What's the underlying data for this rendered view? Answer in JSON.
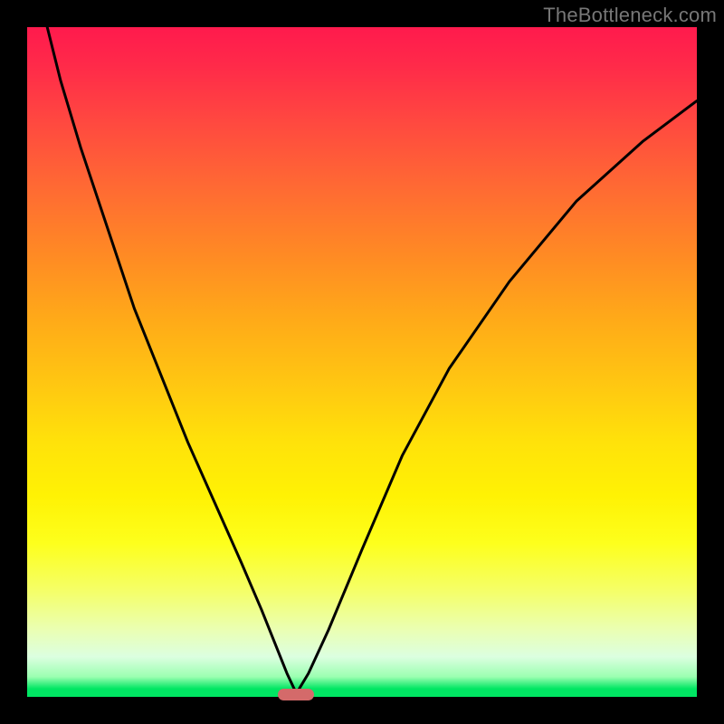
{
  "watermark": "TheBottleneck.com",
  "colors": {
    "frame": "#000000",
    "curve": "#000000",
    "marker": "#d46a6a",
    "green": "#00e663",
    "yellow": "#fff204",
    "orange": "#ff8a24",
    "red": "#ff1a4d"
  },
  "chart_data": {
    "type": "line",
    "title": "",
    "xlabel": "",
    "ylabel": "",
    "xlim": [
      0,
      100
    ],
    "ylim": [
      0,
      100
    ],
    "annotations": [
      {
        "name": "ideal-marker",
        "x": 40.2,
        "y": 0.3,
        "shape": "pill"
      }
    ],
    "series": [
      {
        "name": "bottleneck-curve",
        "x": [
          3,
          5,
          8,
          12,
          16,
          20,
          24,
          28,
          32,
          35,
          37,
          38.8,
          40.2,
          42,
          45,
          50,
          56,
          63,
          72,
          82,
          92,
          100
        ],
        "values": [
          100,
          92,
          82,
          70,
          58,
          48,
          38,
          29,
          20,
          13,
          8,
          3.5,
          0.5,
          3.5,
          10,
          22,
          36,
          49,
          62,
          74,
          83,
          89
        ]
      }
    ],
    "background_gradient": [
      {
        "pos": 0,
        "color": "#ff1a4d"
      },
      {
        "pos": 0.44,
        "color": "#ffab18"
      },
      {
        "pos": 0.7,
        "color": "#fff204"
      },
      {
        "pos": 0.97,
        "color": "#9bffb1"
      },
      {
        "pos": 1.0,
        "color": "#00e663"
      }
    ]
  }
}
